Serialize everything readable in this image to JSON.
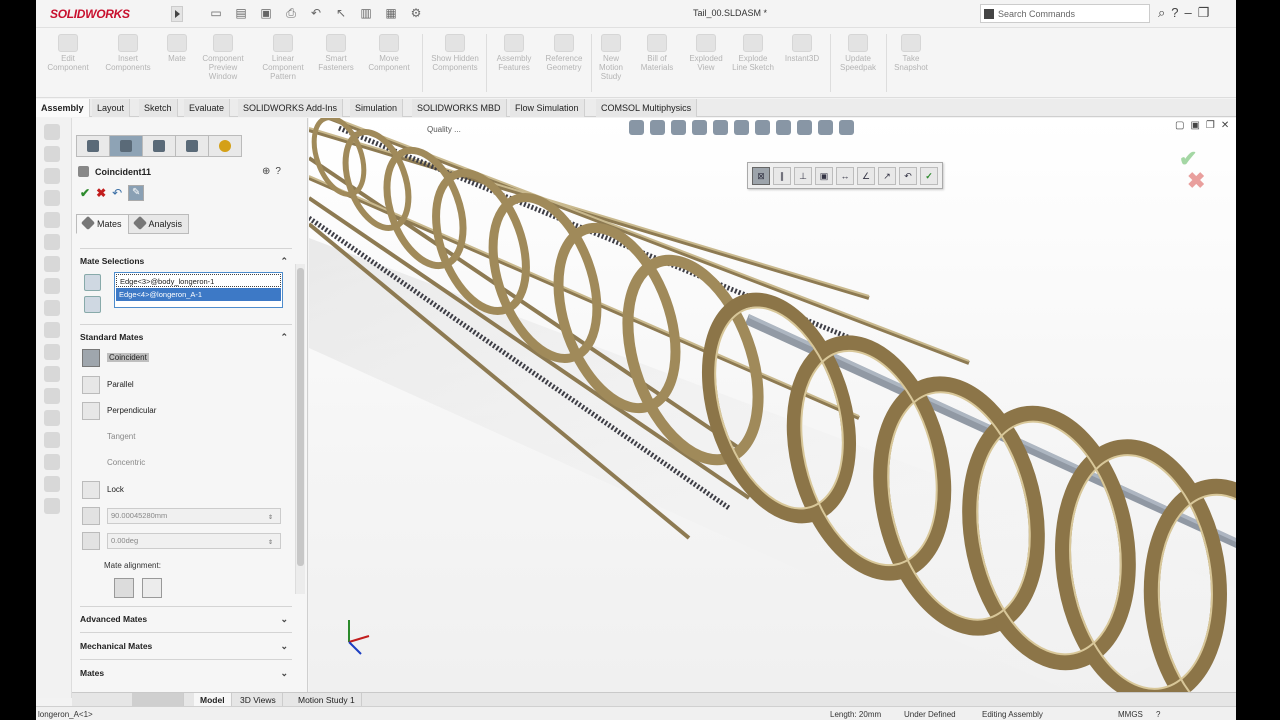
{
  "app": {
    "brand": "SOLIDWORKS",
    "document_title": "Tail_00.SLDASM *",
    "search_placeholder": "Search Commands"
  },
  "command_manager": {
    "items": [
      {
        "label": "Edit Component"
      },
      {
        "label": "Insert Components"
      },
      {
        "label": "Mate"
      },
      {
        "label": "Component Preview Window"
      },
      {
        "label": "Linear Component Pattern"
      },
      {
        "label": "Smart Fasteners"
      },
      {
        "label": "Move Component"
      },
      {
        "label": "Show Hidden Components"
      },
      {
        "label": "Assembly Features"
      },
      {
        "label": "Reference Geometry"
      },
      {
        "label": "New Motion Study"
      },
      {
        "label": "Bill of Materials"
      },
      {
        "label": "Exploded View"
      },
      {
        "label": "Explode Line Sketch"
      },
      {
        "label": "Instant3D"
      },
      {
        "label": "Update Speedpak"
      },
      {
        "label": "Take Snapshot"
      }
    ]
  },
  "tabs": [
    {
      "label": "Assembly",
      "active": true
    },
    {
      "label": "Layout"
    },
    {
      "label": "Sketch"
    },
    {
      "label": "Evaluate"
    },
    {
      "label": "SOLIDWORKS Add-Ins"
    },
    {
      "label": "Simulation"
    },
    {
      "label": "SOLIDWORKS MBD"
    },
    {
      "label": "Flow Simulation"
    },
    {
      "label": "COMSOL Multiphysics"
    }
  ],
  "property_manager": {
    "title": "Coincident11",
    "subtabs": {
      "mates": "Mates",
      "analysis": "Analysis"
    },
    "mate_selections": {
      "header": "Mate Selections",
      "items": [
        "Edge<3>@body_longeron-1",
        "Edge<4>@longeron_A-1"
      ]
    },
    "standard_mates": {
      "header": "Standard Mates",
      "items": [
        {
          "label": "Coincident",
          "selected": true
        },
        {
          "label": "Parallel"
        },
        {
          "label": "Perpendicular"
        },
        {
          "label": "Tangent",
          "disabled": true
        },
        {
          "label": "Concentric",
          "disabled": true
        },
        {
          "label": "Lock"
        }
      ],
      "distance_value": "90.00045280mm",
      "angle_value": "0.00deg",
      "alignment_label": "Mate alignment:"
    },
    "sections": {
      "advanced": "Advanced Mates",
      "mechanical": "Mechanical Mates",
      "mates": "Mates"
    }
  },
  "viewport": {
    "caption": "Quality ..."
  },
  "bottom_tabs": [
    {
      "label": "Model",
      "active": true
    },
    {
      "label": "3D Views"
    },
    {
      "label": "Motion Study 1"
    }
  ],
  "status_bar": {
    "left": "longeron_A<1>",
    "length": "Length: 20mm",
    "state": "Under Defined",
    "mode": "Editing Assembly",
    "units": "MMGS"
  },
  "colors": {
    "frame_wood": "#a08a5a",
    "ring_face": "#8c7548",
    "highlight_blue": "#3d79c6",
    "brand_red": "#c8102e"
  }
}
